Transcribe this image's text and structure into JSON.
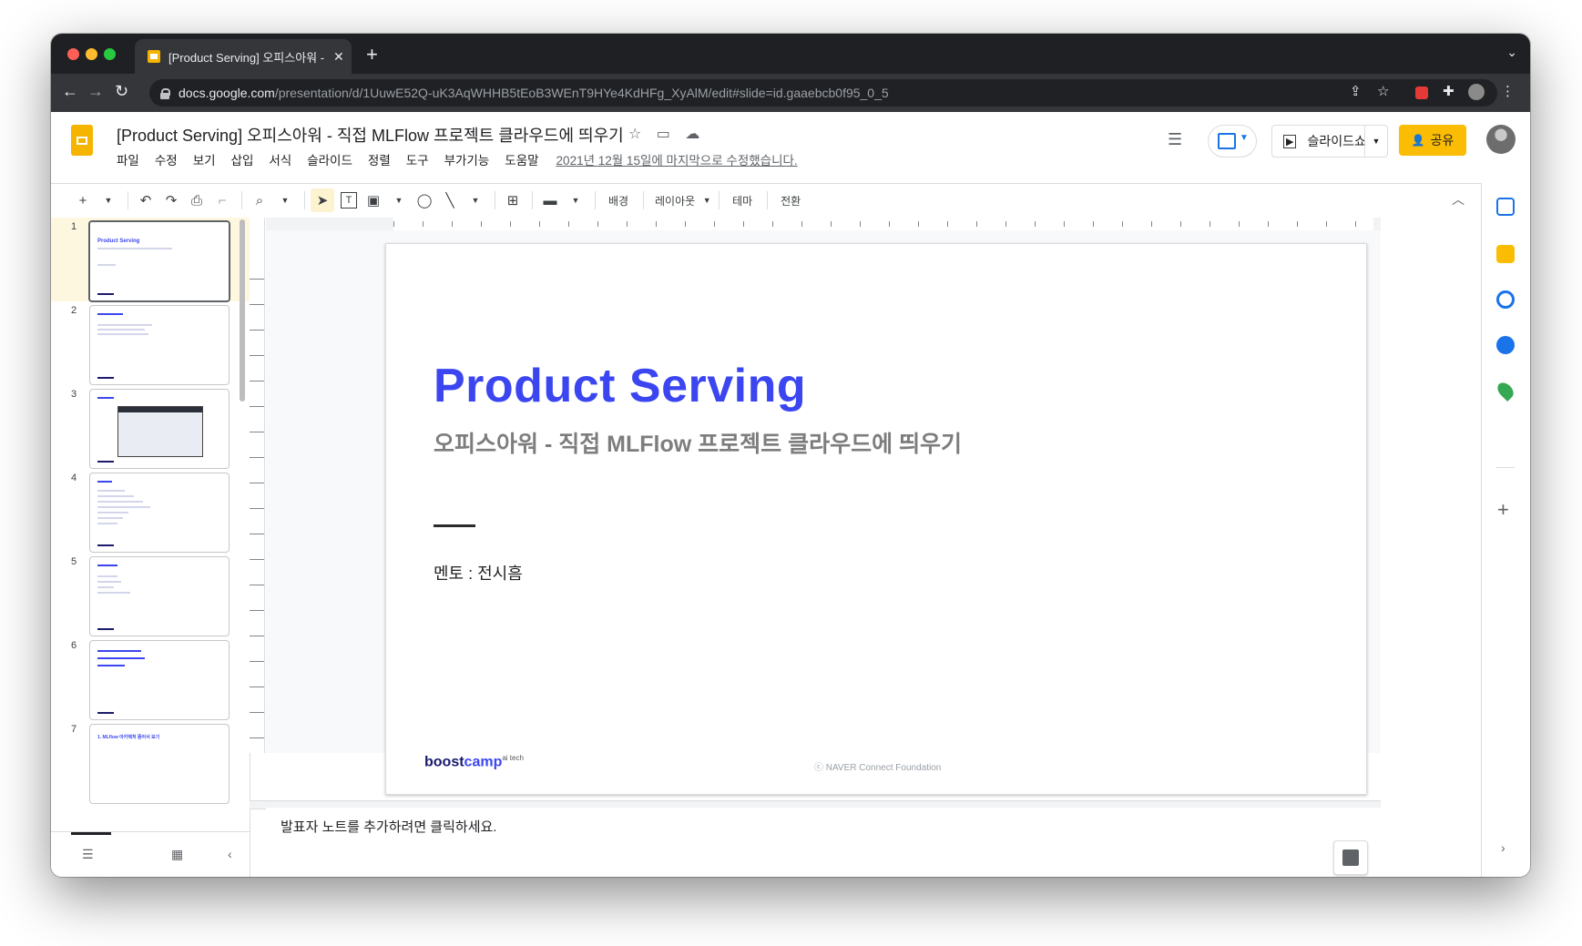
{
  "browser": {
    "tab_title": "[Product Serving] 오피스아워 - 직",
    "tab_close": "✕",
    "new_tab": "+",
    "url_host": "docs.google.com",
    "url_path": "/presentation/d/1UuwE52Q-uK3AqWHHB5tEoB3WEnT9HYe4KdHFg_XyAlM/edit#slide=id.gaaebcb0f95_0_5"
  },
  "app": {
    "title": "[Product Serving] 오피스아워 - 직접 MLFlow 프로젝트 클라우드에 띄우기",
    "menu": [
      "파일",
      "수정",
      "보기",
      "삽입",
      "서식",
      "슬라이드",
      "정렬",
      "도구",
      "부가기능",
      "도움말"
    ],
    "last_edit": "2021년 12월 15일에 마지막으로 수정했습니다.",
    "slideshow_label": "슬라이드쇼",
    "share_label": "공유"
  },
  "toolbar": {
    "background": "배경",
    "layout": "레이아웃",
    "theme": "테마",
    "transition": "전환"
  },
  "filmstrip": {
    "slides": [
      {
        "num": "1",
        "title": "Product Serving"
      },
      {
        "num": "2",
        "title": ""
      },
      {
        "num": "3",
        "title": ""
      },
      {
        "num": "4",
        "title": ""
      },
      {
        "num": "5",
        "title": ""
      },
      {
        "num": "6",
        "title": ""
      },
      {
        "num": "7",
        "title": "1. MLflow 아키텍처 뜯어서 보기"
      }
    ]
  },
  "slide": {
    "title": "Product Serving",
    "subtitle": "오피스아워 - 직접 MLFlow 프로젝트 클라우드에 띄우기",
    "mentor": "멘토 : 전시흠",
    "logo_main": "boost",
    "logo_camp": "camp",
    "logo_sup": "ai tech",
    "copyright": "ⓒ  NAVER Connect Foundation"
  },
  "notes": {
    "placeholder": "발표자 노트를 추가하려면 클릭하세요."
  },
  "colors": {
    "accent": "#3b46f0",
    "share": "#fbbc04",
    "chrome_dark": "#1f2023"
  }
}
